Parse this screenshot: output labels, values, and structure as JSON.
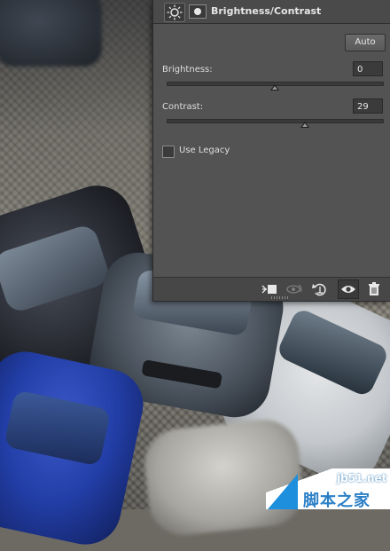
{
  "panel": {
    "title": "Brightness/Contrast",
    "auto_label": "Auto",
    "brightness": {
      "label": "Brightness:",
      "value": "0",
      "level_fraction": 0.5
    },
    "contrast": {
      "label": "Contrast:",
      "value": "29",
      "level_fraction": 0.64
    },
    "use_legacy": {
      "label": "Use Legacy",
      "checked": false
    },
    "header_icons": [
      "brightness-adjustment-icon",
      "layer-mask-icon"
    ],
    "footer_icons": [
      "clip-to-layer-icon",
      "view-previous-state-icon",
      "reset-icon",
      "visibility-eye-icon",
      "trash-icon"
    ]
  },
  "watermark": {
    "url": "jb51.net",
    "name": "脚本之家"
  },
  "colors": {
    "panel_bg": "#535353",
    "panel_header": "#4a4a4a",
    "field_bg": "#3b3b3b",
    "text": "#e6e6e6",
    "watermark_blue": "#1d8fdc"
  }
}
